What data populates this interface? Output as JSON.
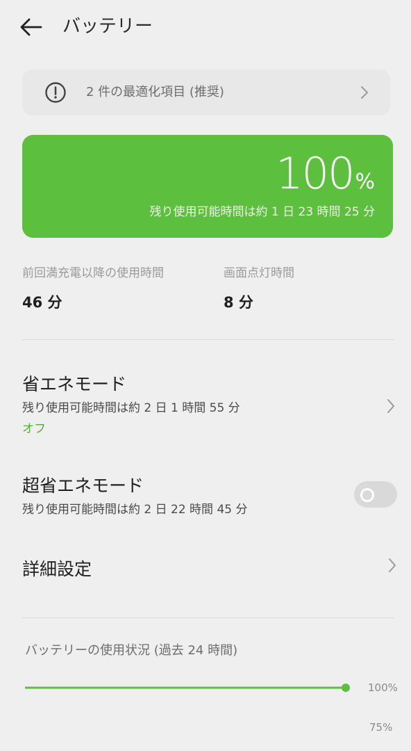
{
  "header": {
    "title": "バッテリー",
    "back_icon": "arrow-left-icon"
  },
  "optimization": {
    "text": "2 件の最適化項目 (推奨)",
    "icon": "alert-circle-icon"
  },
  "battery": {
    "percent_value": "100",
    "percent_unit": "%",
    "level": 1.0,
    "remaining": "残り使用可能時間は約 1 日 23 時間 25 分",
    "accent_color": "#5cbf3e"
  },
  "stats": {
    "since_charge_label": "前回満充電以降の使用時間",
    "since_charge_value": "46 分",
    "screen_on_label": "画面点灯時間",
    "screen_on_value": "8 分"
  },
  "power_saving": {
    "title": "省エネモード",
    "subtitle": "残り使用可能時間は約 2 日 1 時間 55 分",
    "status": "オフ"
  },
  "super_power_saving": {
    "title": "超省エネモード",
    "subtitle": "残り使用可能時間は約 2 日 22 時間 45 分",
    "enabled": false
  },
  "advanced": {
    "title": "詳細設定"
  },
  "usage": {
    "title": "バッテリーの使用状況 (過去 24 時間)"
  },
  "chart_data": {
    "type": "line",
    "title": "バッテリーの使用状況 (過去 24 時間)",
    "y_ticks": [
      "100%",
      "75%"
    ],
    "x": [
      0,
      1
    ],
    "series": [
      {
        "values": [
          100,
          100
        ]
      }
    ],
    "ylim": [
      75,
      100
    ],
    "line_color": "#5cbf3e"
  }
}
